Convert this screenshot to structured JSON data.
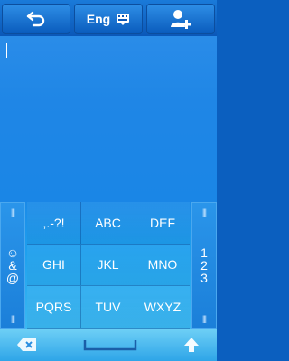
{
  "toolbar": {
    "back_icon": "back-arrow-icon",
    "language_label": "Eng",
    "keyboard_icon": "keyboard-icon",
    "contact_icon": "add-contact-icon"
  },
  "editor": {
    "text": ""
  },
  "keypad": {
    "left_side_label": "☺\n&\n@",
    "right_side_label": "1\n2\n3",
    "keys": [
      ",.-?!",
      "ABC",
      "DEF",
      "GHI",
      "JKL",
      "MNO",
      "PQRS",
      "TUV",
      "WXYZ"
    ]
  },
  "bottombar": {
    "delete_icon": "backspace-icon",
    "space_icon": "space-icon",
    "shift_icon": "shift-up-icon"
  },
  "colors": {
    "accent": "#1f86e6",
    "toolbar": "#0b58b8",
    "bottom": "#4bbcf0"
  }
}
